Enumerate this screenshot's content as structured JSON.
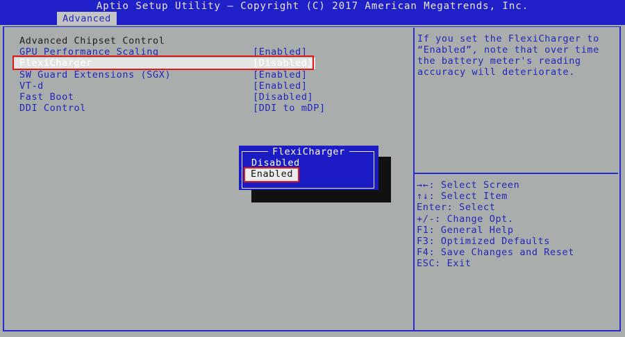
{
  "header": {
    "title": "Aptio Setup Utility – Copyright (C) 2017 American Megatrends, Inc.",
    "active_tab": "Advanced"
  },
  "settings": {
    "section_title": "Advanced Chipset Control",
    "items": [
      {
        "label": "GPU Performance Scaling",
        "value": "[Enabled]"
      },
      {
        "label": "FlexiCharger",
        "value": "[Disabled]"
      },
      {
        "label": "SW Guard Extensions (SGX)",
        "value": "[Enabled]"
      },
      {
        "label": "VT-d",
        "value": "[Enabled]"
      },
      {
        "label": "Fast Boot",
        "value": "[Disabled]"
      },
      {
        "label": "DDI Control",
        "value": "[DDI to mDP]"
      }
    ]
  },
  "help_text": "If you set the FlexiCharger to “Enabled”, note that over time the battery meter's reading accuracy will deteriorate.",
  "key_help": [
    "→←: Select Screen",
    "↑↓: Select Item",
    "Enter: Select",
    "+/-: Change Opt.",
    "F1: General Help",
    "F3: Optimized Defaults",
    "F4: Save Changes and Reset",
    "ESC: Exit"
  ],
  "popup": {
    "title": "FlexiCharger",
    "options": [
      "Disabled",
      "Enabled"
    ],
    "selected": "Enabled"
  },
  "colors": {
    "bios_blue": "#2020c8",
    "background_gray": "#a9aeac",
    "highlight_red": "#e01818"
  }
}
